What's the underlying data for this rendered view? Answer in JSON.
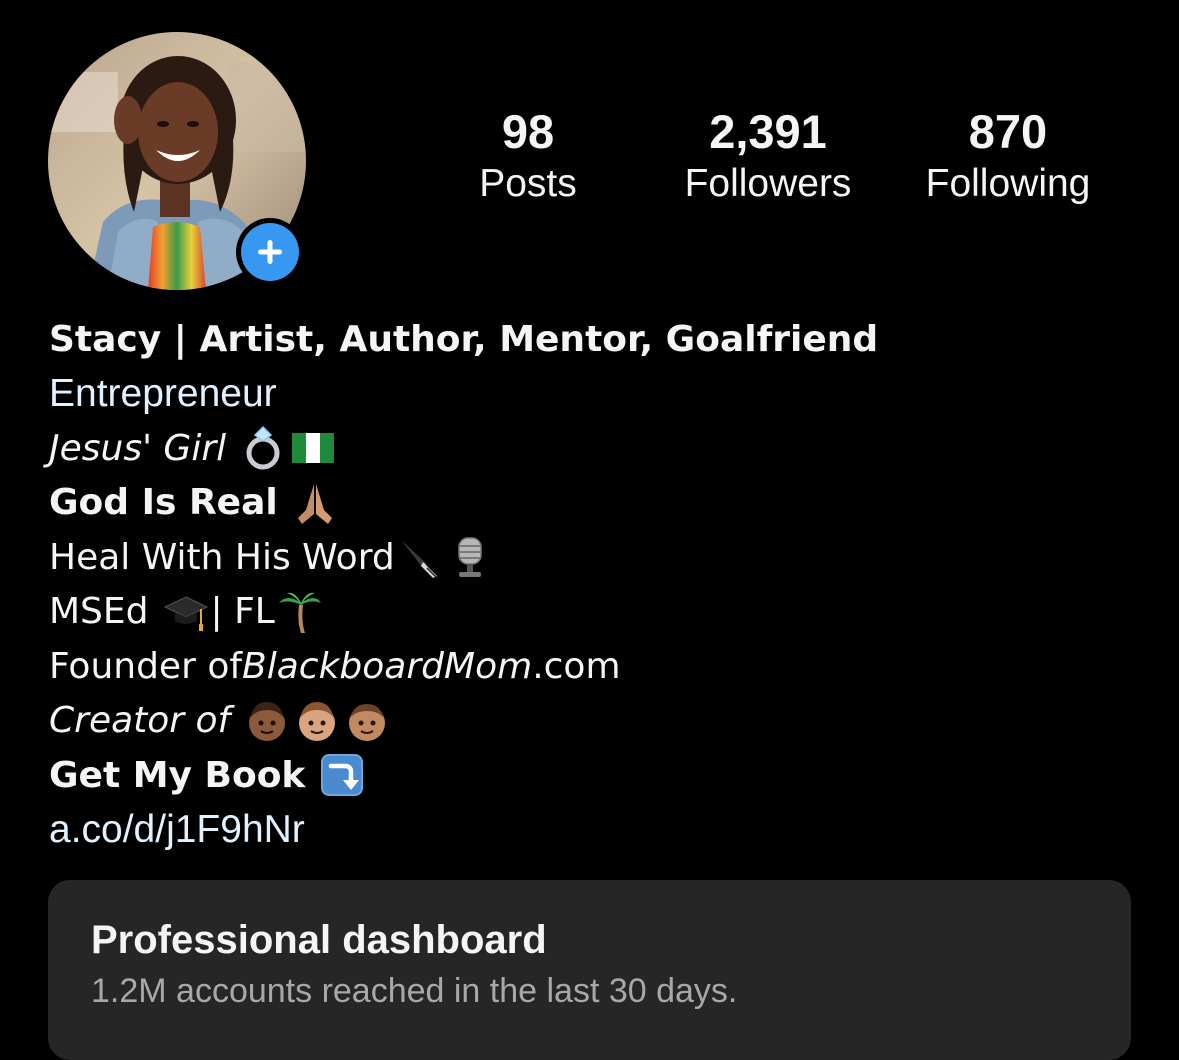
{
  "profile": {
    "avatar_alt": "profile photo",
    "add_story_icon": "plus-icon",
    "colors": {
      "accent": "#3897f0",
      "link": "#e0f1ff",
      "background": "#000000",
      "card": "#262626",
      "muted": "#a8a8a8"
    }
  },
  "stats": {
    "posts": {
      "value": "98",
      "label": "Posts"
    },
    "followers": {
      "value": "2,391",
      "label": "Followers"
    },
    "following": {
      "value": "870",
      "label": "Following"
    }
  },
  "bio": {
    "name": "Stacy | Artist, Author, Mentor, Goalfriend",
    "category": "Entrepreneur",
    "line_jesus": "Jesus' Girl",
    "line_god": "God Is Real",
    "line_heal": "Heal With His Word",
    "line_msed_a": "MSEd",
    "line_msed_b": "| FL",
    "line_founder_a": "Founder of ",
    "line_founder_b": "BlackboardMom",
    "line_founder_c": ".com",
    "line_creator": "Creator of",
    "line_book": "Get My Book",
    "link": "a.co/d/j1F9hNr",
    "emojis": [
      "ring",
      "nigeria-flag",
      "praying-hands",
      "fountain-pen",
      "microphone",
      "graduation-cap",
      "palm-tree",
      "boy",
      "boy",
      "boy",
      "arrow-down-right"
    ]
  },
  "dashboard": {
    "title": "Professional dashboard",
    "subtitle": "1.2M accounts reached in the last 30 days."
  }
}
